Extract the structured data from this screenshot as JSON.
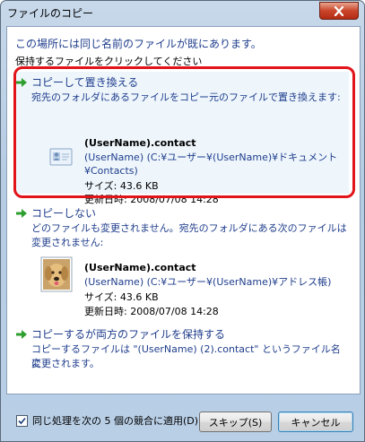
{
  "window": {
    "title": "ファイルのコピー"
  },
  "header": {
    "heading": "この場所には同じ名前のファイルが既にあります。",
    "subheading": "保持するファイルをクリックしてください"
  },
  "options": [
    {
      "title": "コピーして置き換える",
      "desc_line1": "宛先のフォルダにあるファイルをコピー元のファイルで置き換えます:",
      "file": {
        "name": "(UserName).contact",
        "path_line1": "(UserName) (C:¥ユーザー¥(UserName)¥ドキュメント",
        "path_line2": "¥Contacts)",
        "size": "サイズ: 43.6 KB",
        "modified": "更新日時: 2008/07/08 14:28",
        "icon": "contact-card-icon"
      }
    },
    {
      "title": "コピーしない",
      "desc_line1": "どのファイルも変更されません。宛先のフォルダにある次のファイルは",
      "desc_line2": "変更されません:",
      "file": {
        "name": "(UserName).contact",
        "path_line1": "(UserName) (C:¥ユーザー¥(UserName)¥アドレス帳)",
        "size": "サイズ: 43.6 KB",
        "modified": "更新日時: 2008/07/08 14:28",
        "icon": "dog-photo-contact-icon"
      }
    },
    {
      "title": "コピーするが両方のファイルを保持する",
      "desc_line1": "コピーするファイルは \"(UserName) (2).contact\" というファイル名に",
      "desc_line2": "変更されます。"
    }
  ],
  "footer": {
    "apply_all_label": "同じ処理を次の 5 個の競合に適用(D)",
    "apply_all_checked": true,
    "skip_label": "スキップ(S)",
    "cancel_label": "キャンセル"
  },
  "colors": {
    "link_blue": "#1f3d8c",
    "arrow_green": "#2e9e2e",
    "selection_red": "#e1141a"
  }
}
